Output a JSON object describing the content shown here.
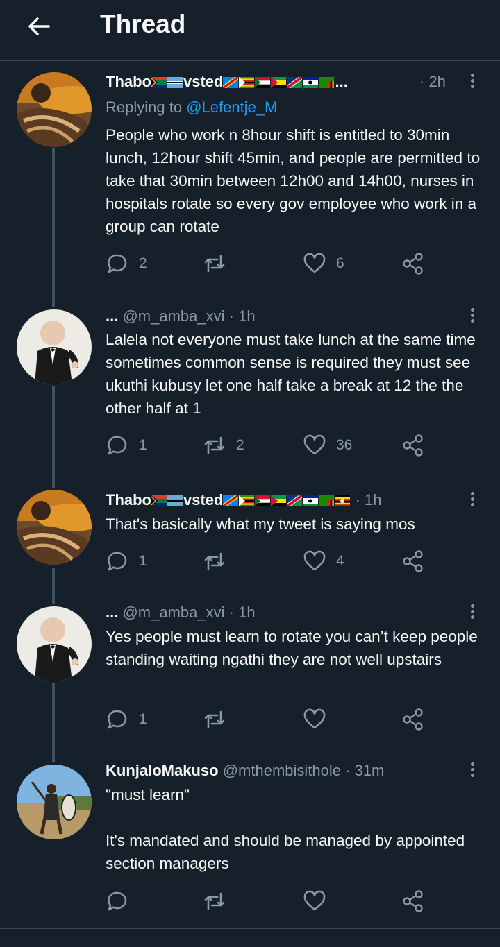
{
  "header": {
    "title": "Thread",
    "back_icon": "arrow-left-icon"
  },
  "tweets": [
    {
      "name": "Thabo",
      "name_suffix": "vsted",
      "handle_tail": "...",
      "time": "· 2h",
      "replying_label": "Replying to",
      "replying_handle": "@Lefentje_M",
      "text": "People who work n 8hour shift is entitled to 30min lunch, 12hour shift 45min, and people are permitted to take that 30min between 12h00 and 14h00, nurses in hospitals rotate so every gov employee who work in a group can rotate",
      "replies": "2",
      "retweets": "",
      "likes": "6"
    },
    {
      "name": "...",
      "handle": "@m_amba_xvi",
      "time": "· 1h",
      "text": "Lalela not everyone must take lunch at the same time sometimes common sense is required they must see ukuthi kubusy let one half take a break at 12 the the other half at 1",
      "replies": "1",
      "retweets": "2",
      "likes": "36"
    },
    {
      "name": "Thabo",
      "name_suffix": "vsted",
      "time": "· 1h",
      "text": "That's basically what my tweet is saying mos",
      "replies": "1",
      "retweets": "",
      "likes": "4"
    },
    {
      "name": "...",
      "handle": "@m_amba_xvi",
      "time": "· 1h",
      "text": "Yes people must learn to rotate you can’t keep people standing waiting ngathi they are not well upstairs",
      "replies": "1",
      "retweets": "",
      "likes": ""
    },
    {
      "name": "KunjaloMakuso",
      "handle": "@mthembisithole",
      "time": "· 31m",
      "text": "\"must learn\"\n\nIt's mandated and should be managed by appointed section managers",
      "replies": "",
      "retweets": "",
      "likes": ""
    }
  ],
  "icons": {
    "reply": "reply-icon",
    "retweet": "retweet-icon",
    "like": "heart-icon",
    "share": "share-icon",
    "more": "more-vertical-icon"
  },
  "colors": {
    "background": "#15202b",
    "text": "#f7f9f9",
    "muted": "#8b98a5",
    "link": "#1d9bf0",
    "thread_line": "#3d5466"
  }
}
